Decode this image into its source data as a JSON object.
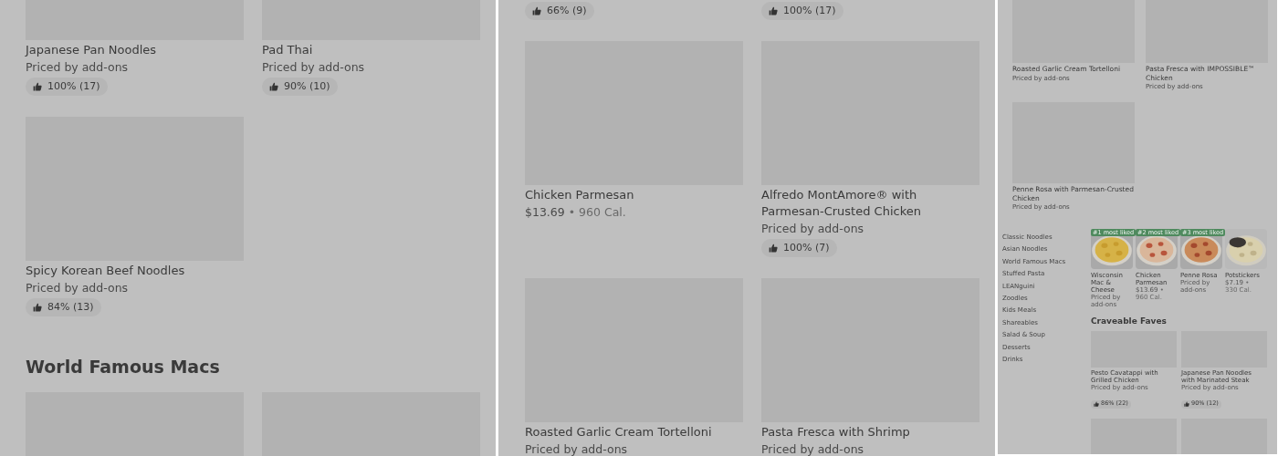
{
  "panels": [
    {
      "kind": "menu",
      "blocks": [
        {
          "kind": "grid",
          "items": [
            {
              "kind": "card",
              "title": "Japanese Pan Noodles",
              "price": "Priced by add-ons",
              "rating": "100% (17)"
            },
            {
              "kind": "card",
              "title": "Pad Thai",
              "price": "Priced by add-ons",
              "rating": "90% (10)"
            },
            {
              "kind": "card",
              "title": "Spicy Korean Beef Noodles",
              "price": "Priced by add-ons",
              "rating": "84% (13)"
            }
          ]
        },
        {
          "kind": "heading",
          "text": "World Famous Macs"
        },
        {
          "kind": "grid",
          "items": [
            {
              "kind": "image-only"
            },
            {
              "kind": "image-only"
            }
          ]
        }
      ]
    },
    {
      "kind": "menu",
      "blocks": [
        {
          "kind": "grid",
          "items": [
            {
              "kind": "card",
              "rating": "66% (9)"
            },
            {
              "kind": "card",
              "rating": "100% (17)"
            },
            {
              "kind": "card",
              "title": "Chicken Parmesan",
              "price": "$13.69",
              "separator": "•",
              "calories": "960 Cal."
            },
            {
              "kind": "card",
              "title": "Alfredo MontAmore® with Parmesan-Crusted Chicken",
              "price": "Priced by add-ons",
              "rating": "100% (7)"
            },
            {
              "kind": "card",
              "title": "Roasted Garlic Cream Tortelloni",
              "price": "Priced by add-ons"
            },
            {
              "kind": "card",
              "title": "Pasta Fresca with Shrimp",
              "price": "Priced by add-ons"
            }
          ]
        }
      ]
    },
    {
      "kind": "menu",
      "blocks": [
        {
          "kind": "grid",
          "items": [
            {
              "kind": "card",
              "title": "Roasted Garlic Cream Tortelloni",
              "price": "Priced by add-ons"
            },
            {
              "kind": "card",
              "title": "Pasta Fresca with IMPOSSIBLE™ Chicken",
              "price": "Priced by add-ons"
            },
            {
              "kind": "card",
              "title": "Penne Rosa with Parmesan-Crusted Chicken",
              "price": "Priced by add-ons"
            }
          ]
        }
      ]
    },
    {
      "kind": "store",
      "categories": [
        "Classic Noodles",
        "Asian Noodles",
        "World Famous Macs",
        "Stuffed Pasta",
        "LEANguini",
        "Zoodles",
        "Kids Meals",
        "Shareables",
        "Salad & Soup",
        "Desserts",
        "Drinks"
      ],
      "blocks": [
        {
          "kind": "carousel",
          "items": [
            {
              "kind": "tile",
              "badge": "#1 most liked",
              "title": "Wisconsin Mac & Cheese",
              "price": "Priced by add-ons"
            },
            {
              "kind": "tile",
              "badge": "#2 most liked",
              "title": "Chicken Parmesan",
              "price": "$13.69",
              "separator": "•",
              "calories": "960 Cal."
            },
            {
              "kind": "tile",
              "badge": "#3 most liked",
              "title": "Penne Rosa",
              "price": "Priced by add-ons"
            },
            {
              "kind": "tile",
              "title": "Potstickers",
              "price": "$7.19",
              "separator": "•",
              "calories": "330 Cal."
            }
          ]
        },
        {
          "kind": "heading",
          "text": "Craveable Faves"
        },
        {
          "kind": "grid",
          "items": [
            {
              "kind": "card",
              "title": "Pesto Cavatappi with Grilled Chicken",
              "price": "Priced by add-ons",
              "rating": "86% (22)"
            },
            {
              "kind": "card",
              "title": "Japanese Pan Noodles with Marinated Steak",
              "price": "Priced by add-ons",
              "rating": "90% (12)"
            },
            {
              "kind": "image-only"
            },
            {
              "kind": "image-only"
            }
          ]
        }
      ]
    }
  ]
}
